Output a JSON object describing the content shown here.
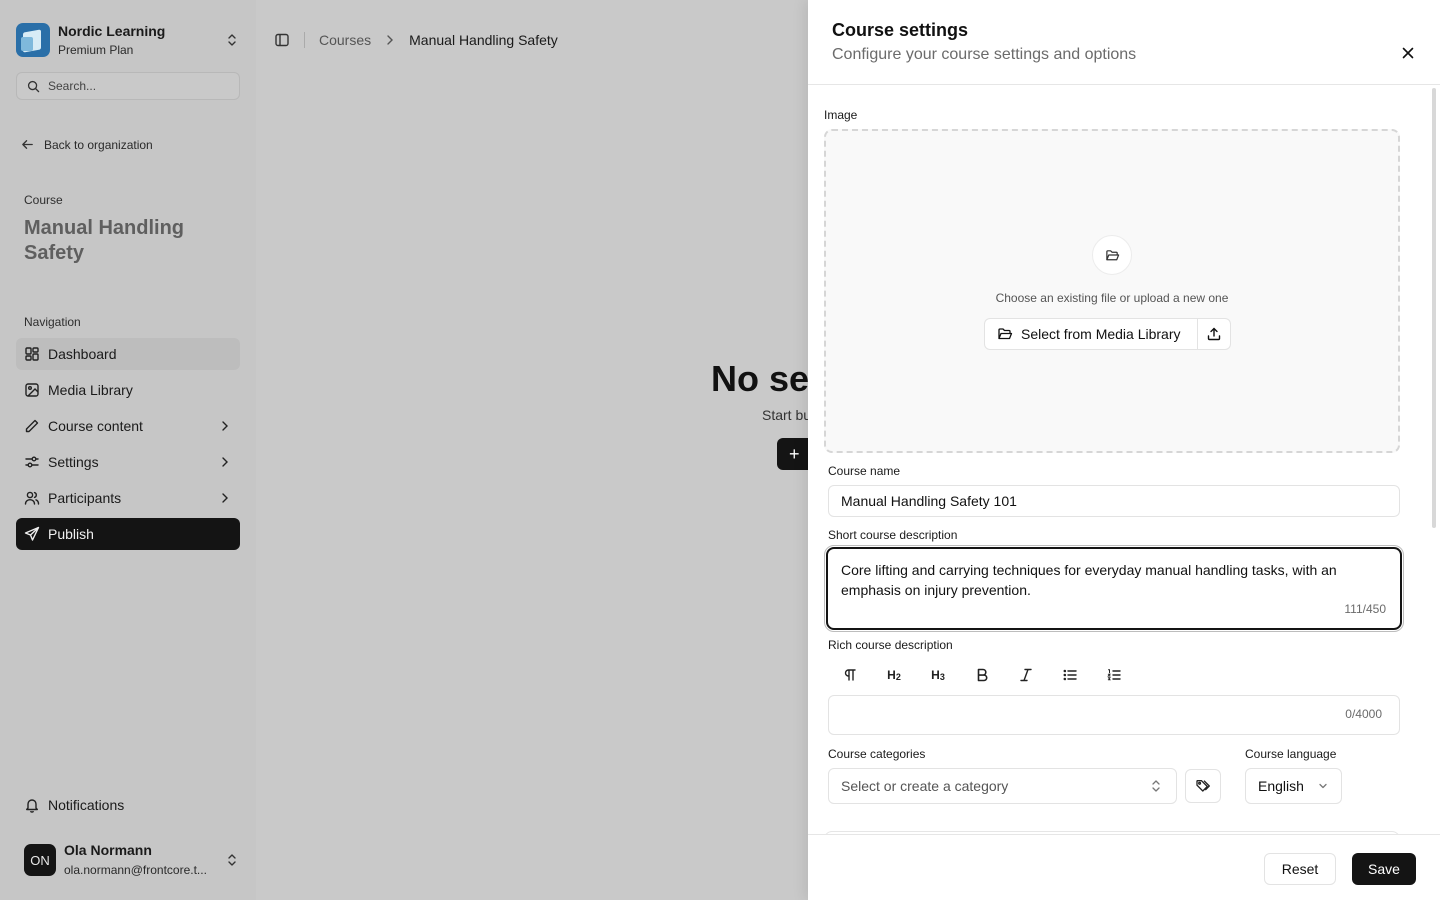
{
  "sidebar": {
    "org_name": "Nordic Learning",
    "org_plan": "Premium Plan",
    "search_placeholder": "Search...",
    "back_label": "Back to organization",
    "course_label": "Course",
    "course_title": "Manual Handling Safety",
    "nav_label": "Navigation",
    "items": [
      {
        "label": "Dashboard",
        "icon": "dashboard-icon"
      },
      {
        "label": "Media Library",
        "icon": "image-icon"
      },
      {
        "label": "Course content",
        "icon": "pencil-icon"
      },
      {
        "label": "Settings",
        "icon": "sliders-icon"
      },
      {
        "label": "Participants",
        "icon": "users-icon"
      },
      {
        "label": "Publish",
        "icon": "send-icon"
      }
    ],
    "notifications_label": "Notifications",
    "user": {
      "initials": "ON",
      "name": "Ola Normann",
      "email": "ola.normann@frontcore.t..."
    }
  },
  "main": {
    "breadcrumb": [
      "Courses",
      "Manual Handling Safety"
    ],
    "empty_title": "No se",
    "empty_sub": "Start bu",
    "empty_button": "+"
  },
  "sheet": {
    "title": "Course settings",
    "description": "Configure your course settings and options",
    "image_label": "Image",
    "dropzone_text": "Choose an existing file or upload a new one",
    "select_media_label": "Select from Media Library",
    "course_name_label": "Course name",
    "course_name_value": "Manual Handling Safety 101",
    "short_desc_label": "Short course description",
    "short_desc_value": "Core lifting and carrying techniques for everyday manual handling tasks, with an emphasis on injury prevention.",
    "short_desc_counter": "111/450",
    "rich_desc_label": "Rich course description",
    "rich_tools": [
      "paragraph",
      "H2",
      "H3",
      "bold",
      "italic",
      "bullet-list",
      "ordered-list"
    ],
    "rich_counter": "0/4000",
    "categories_label": "Course categories",
    "categories_placeholder": "Select or create a category",
    "language_label": "Course language",
    "language_value": "English",
    "reset_label": "Reset",
    "save_label": "Save"
  }
}
